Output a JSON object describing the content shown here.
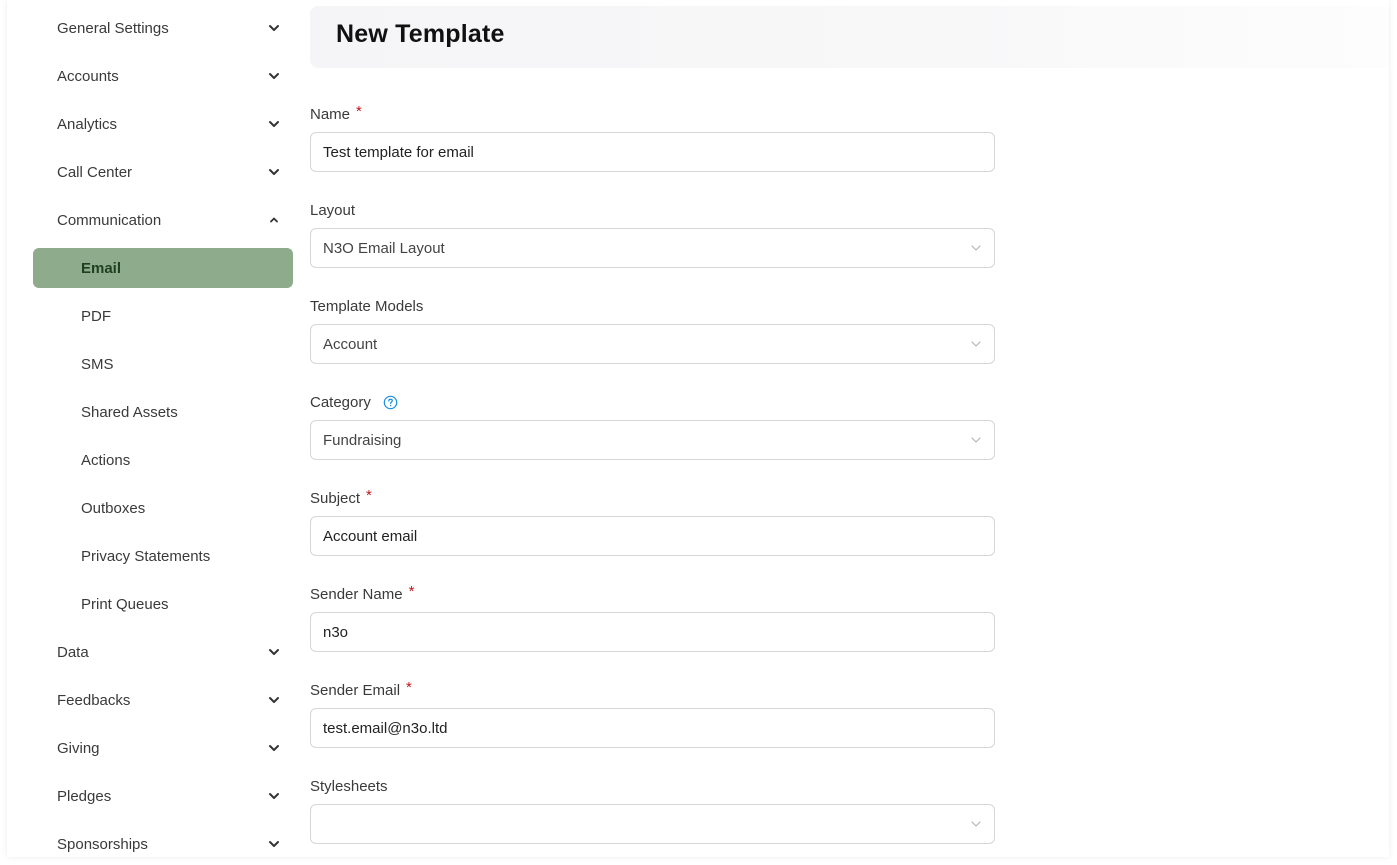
{
  "sidebar": {
    "items": [
      {
        "label": "General Settings"
      },
      {
        "label": "Accounts"
      },
      {
        "label": "Analytics"
      },
      {
        "label": "Call Center"
      },
      {
        "label": "Communication"
      },
      {
        "label": "Data"
      },
      {
        "label": "Feedbacks"
      },
      {
        "label": "Giving"
      },
      {
        "label": "Pledges"
      },
      {
        "label": "Sponsorships"
      }
    ],
    "communication_subitems": [
      {
        "label": "Email"
      },
      {
        "label": "PDF"
      },
      {
        "label": "SMS"
      },
      {
        "label": "Shared Assets"
      },
      {
        "label": "Actions"
      },
      {
        "label": "Outboxes"
      },
      {
        "label": "Privacy Statements"
      },
      {
        "label": "Print Queues"
      }
    ]
  },
  "header": {
    "title": "New Template"
  },
  "form": {
    "name": {
      "label": "Name",
      "required": "*",
      "value": "Test template for email"
    },
    "layout": {
      "label": "Layout",
      "value": "N3O Email Layout"
    },
    "template_models": {
      "label": "Template Models",
      "value": "Account"
    },
    "category": {
      "label": "Category",
      "value": "Fundraising",
      "help_icon": "question-circle-icon"
    },
    "subject": {
      "label": "Subject",
      "required": "*",
      "value": "Account email"
    },
    "sender_name": {
      "label": "Sender Name",
      "required": "*",
      "value": "n3o"
    },
    "sender_email": {
      "label": "Sender Email",
      "required": "*",
      "value": "test.email@n3o.ltd"
    },
    "stylesheets": {
      "label": "Stylesheets",
      "value": ""
    }
  },
  "colors": {
    "accent": "#8eab8c",
    "active_text": "#1f3f22",
    "required": "#c0161b",
    "help": "#1a8ee0"
  }
}
